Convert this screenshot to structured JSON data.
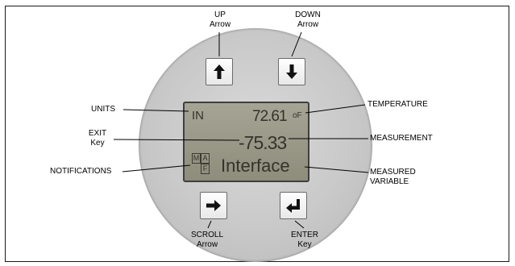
{
  "labels": {
    "up_arrow": "UP\nArrow",
    "down_arrow": "DOWN\nArrow",
    "units": "UNITS",
    "exit_key": "EXIT\nKey",
    "notifications": "NOTIFICATIONS",
    "temperature": "TEMPERATURE",
    "measurement": "MEASUREMENT",
    "measured_variable": "MEASURED\nVARIABLE",
    "scroll_arrow": "SCROLL\nArrow",
    "enter_key": "ENTER\nKey"
  },
  "display": {
    "units": "IN",
    "temperature": "72.61",
    "temperature_unit": "oF",
    "measurement": "-75.33",
    "variable": "Interface",
    "flags": [
      "M",
      "A",
      "F"
    ]
  },
  "icons": {
    "up_key": "arrow-up-icon",
    "down_key": "arrow-down-icon",
    "scroll_key": "arrow-right-icon",
    "enter_key": "enter-return-icon"
  }
}
